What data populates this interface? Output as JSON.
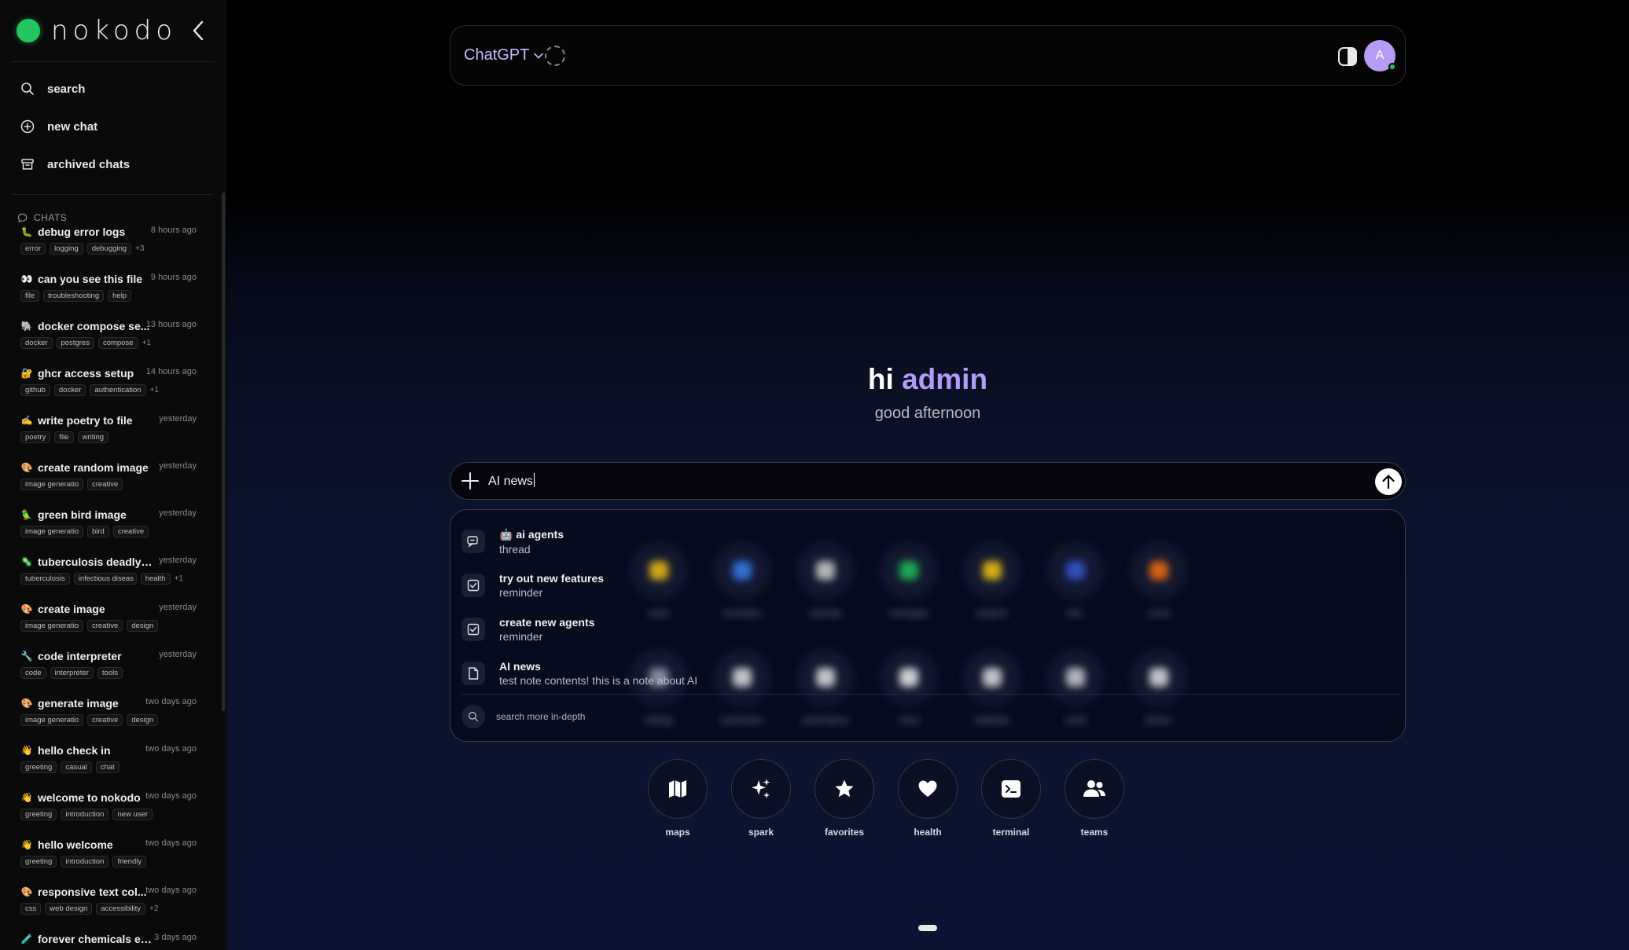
{
  "sidebar": {
    "logo_text": "nokodo",
    "nav": [
      {
        "label": "search",
        "icon": "search-icon"
      },
      {
        "label": "new chat",
        "icon": "plus-circle-icon"
      },
      {
        "label": "archived chats",
        "icon": "archive-icon"
      }
    ],
    "chats_header": "CHATS",
    "chats": [
      {
        "emoji": "🐛",
        "title": "debug error logs",
        "time": "8 hours ago",
        "tags": [
          "error",
          "logging",
          "debugging"
        ],
        "more": "+3"
      },
      {
        "emoji": "👀",
        "title": "can you see this file",
        "time": "9 hours ago",
        "tags": [
          "file",
          "troubleshooting",
          "help"
        ],
        "more": ""
      },
      {
        "emoji": "🐘",
        "title": "docker compose se...",
        "time": "13 hours ago",
        "tags": [
          "docker",
          "postgres",
          "compose"
        ],
        "more": "+1"
      },
      {
        "emoji": "🔐",
        "title": "ghcr access setup",
        "time": "14 hours ago",
        "tags": [
          "github",
          "docker",
          "authentication"
        ],
        "more": "+1"
      },
      {
        "emoji": "✍️",
        "title": "write poetry to file",
        "time": "yesterday",
        "tags": [
          "poetry",
          "file",
          "writing"
        ],
        "more": ""
      },
      {
        "emoji": "🎨",
        "title": "create random image",
        "time": "yesterday",
        "tags": [
          "image generatio",
          "creative"
        ],
        "more": ""
      },
      {
        "emoji": "🦜",
        "title": "green bird image",
        "time": "yesterday",
        "tags": [
          "image generatio",
          "bird",
          "creative"
        ],
        "more": ""
      },
      {
        "emoji": "🦠",
        "title": "tuberculosis deadly to...",
        "time": "yesterday",
        "tags": [
          "tuberculosis",
          "infectious diseas",
          "health"
        ],
        "more": "+1"
      },
      {
        "emoji": "🎨",
        "title": "create image",
        "time": "yesterday",
        "tags": [
          "image generatio",
          "creative",
          "design"
        ],
        "more": ""
      },
      {
        "emoji": "🔧",
        "title": "code interpreter",
        "time": "yesterday",
        "tags": [
          "code",
          "interpreter",
          "tools"
        ],
        "more": ""
      },
      {
        "emoji": "🎨",
        "title": "generate image",
        "time": "two days ago",
        "tags": [
          "image generatio",
          "creative",
          "design"
        ],
        "more": ""
      },
      {
        "emoji": "👋",
        "title": "hello check in",
        "time": "two days ago",
        "tags": [
          "greeting",
          "casual",
          "chat"
        ],
        "more": ""
      },
      {
        "emoji": "👋",
        "title": "welcome to nokodo",
        "time": "two days ago",
        "tags": [
          "greeting",
          "introduction",
          "new user"
        ],
        "more": ""
      },
      {
        "emoji": "👋",
        "title": "hello welcome",
        "time": "two days ago",
        "tags": [
          "greeting",
          "introduction",
          "friendly"
        ],
        "more": ""
      },
      {
        "emoji": "🎨",
        "title": "responsive text col...",
        "time": "two days ago",
        "tags": [
          "css",
          "web design",
          "accessibility"
        ],
        "more": "+2"
      },
      {
        "emoji": "🧪",
        "title": "forever chemicals ex...",
        "time": "3 days ago",
        "tags": [],
        "more": ""
      }
    ]
  },
  "topbar": {
    "model": "ChatGPT",
    "avatar_initial": "A"
  },
  "greeting": {
    "hi": "hi",
    "name": "admin",
    "sub": "good afternoon"
  },
  "input": {
    "value": "AI news"
  },
  "suggestions": [
    {
      "title": "ai agents",
      "title_emoji": "🤖",
      "sub": "thread",
      "icon": "chat-icon"
    },
    {
      "title": "try out new features",
      "title_emoji": "",
      "sub": "reminder",
      "icon": "checkbox-icon"
    },
    {
      "title": "create new agents",
      "title_emoji": "",
      "sub": "reminder",
      "icon": "checkbox-icon"
    },
    {
      "title": "AI news",
      "title_emoji": "",
      "sub": "test note contents! this is a note about AI",
      "icon": "document-icon"
    }
  ],
  "search_more": "search more in-depth",
  "background_apps": [
    {
      "label": "notes",
      "color": "#f5c518"
    },
    {
      "label": "reminders",
      "color": "#3b82f6"
    },
    {
      "label": "calendar",
      "color": "#d4d4d4"
    },
    {
      "label": "messages",
      "color": "#22c55e"
    },
    {
      "label": "projects",
      "color": "#facc15"
    },
    {
      "label": "files",
      "color": "#3b5bdb"
    },
    {
      "label": "social",
      "color": "#f97316"
    },
    {
      "label": "settings",
      "color": "#9ca3af"
    },
    {
      "label": "bookmarks",
      "color": "#e5e7eb"
    },
    {
      "label": "automations",
      "color": "#e5e7eb"
    },
    {
      "label": "cloud",
      "color": "#f3f4f6"
    },
    {
      "label": "database",
      "color": "#e5e7eb"
    },
    {
      "label": "world",
      "color": "#d1d5db"
    },
    {
      "label": "photos",
      "color": "#e5e7eb"
    }
  ],
  "quick_actions": [
    {
      "label": "maps",
      "icon": "map-icon"
    },
    {
      "label": "spark",
      "icon": "sparkle-icon"
    },
    {
      "label": "favorites",
      "icon": "star-icon"
    },
    {
      "label": "health",
      "icon": "heart-icon"
    },
    {
      "label": "terminal",
      "icon": "terminal-icon"
    },
    {
      "label": "teams",
      "icon": "users-icon"
    }
  ],
  "colors": {
    "accent": "#b39cf7",
    "status_online": "#22c55e"
  }
}
